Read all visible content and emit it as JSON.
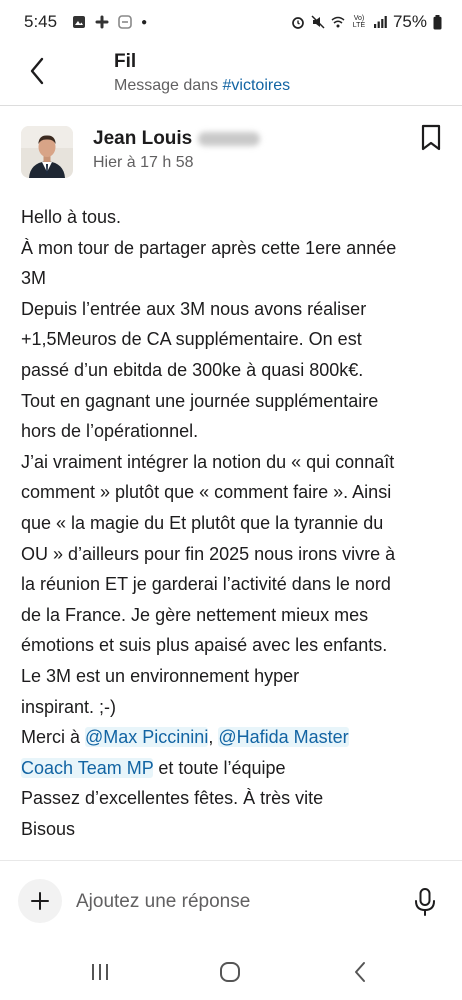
{
  "status_bar": {
    "time": "5:45",
    "battery_text": "75%",
    "network_label": "Vo) LTE"
  },
  "header": {
    "title": "Fil",
    "subtitle_prefix": "Message dans ",
    "channel": "#victoires"
  },
  "message": {
    "author_name": "Jean Louis",
    "timestamp": "Hier à 17 h 58",
    "lines": [
      "Hello à tous.",
      "À mon tour de partager après cette 1ere année",
      "3M",
      "Depuis l’entrée aux 3M nous avons réaliser",
      "+1,5Meuros de CA supplémentaire. On est",
      "passé d’un ebitda de 300ke à quasi 800k€.",
      "Tout en gagnant une journée supplémentaire",
      "hors de l’opérationnel.",
      "J’ai vraiment intégrer la notion du « qui connaît",
      "comment » plutôt que « comment faire ». Ainsi",
      "que « la magie du Et  plutôt que la tyrannie du",
      "OU » d’ailleurs pour fin 2025 nous irons vivre à",
      "la réunion ET je garderai l’activité dans le nord",
      "de la France. Je gère nettement mieux mes",
      "émotions et suis plus apaisé avec les enfants.",
      "Le 3M est un environnement hyper",
      "inspirant. ;-)"
    ],
    "thanks_prefix": "Merci à ",
    "mention_1": "@Max Piccinini",
    "thanks_separator": ", ",
    "mention_2_part1": "@Hafida Master",
    "mention_2_part2": "Coach Team MP",
    "thanks_suffix": " et toute l’équipe",
    "closing_lines": [
      "Passez d’excellentes fêtes. À très vite",
      "Bisous"
    ]
  },
  "composer": {
    "placeholder": "Ajoutez une réponse"
  },
  "colors": {
    "link": "#1264a3",
    "mention_bg": "#e8f5fa",
    "text": "#1d1c1d",
    "muted": "#616061"
  },
  "icons": {
    "back": "chevron-left-icon",
    "bookmark": "bookmark-icon",
    "add": "plus-icon",
    "mic": "microphone-icon",
    "nav_recents": "recents-icon",
    "nav_home": "home-icon",
    "nav_back": "nav-back-icon"
  }
}
